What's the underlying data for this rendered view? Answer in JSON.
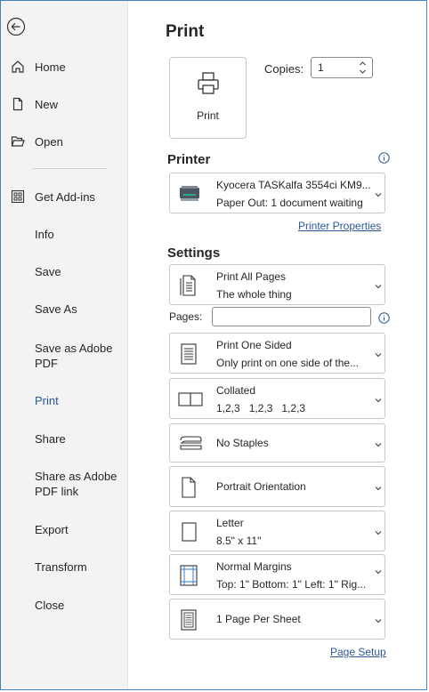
{
  "nav": {
    "back_label": "",
    "items": [
      {
        "label": "Home",
        "icon": "home-icon"
      },
      {
        "label": "New",
        "icon": "new-document-icon"
      },
      {
        "label": "Open",
        "icon": "folder-open-icon"
      },
      {
        "label": "Get Add-ins",
        "icon": "add-ins-icon"
      },
      {
        "label": "Info"
      },
      {
        "label": "Save"
      },
      {
        "label": "Save As"
      },
      {
        "label": "Save as Adobe PDF"
      },
      {
        "label": "Print",
        "active": true
      },
      {
        "label": "Share"
      },
      {
        "label": "Share as Adobe PDF link"
      },
      {
        "label": "Export"
      },
      {
        "label": "Transform"
      },
      {
        "label": "Close"
      }
    ]
  },
  "main": {
    "title": "Print",
    "print_button_label": "Print",
    "copies_label": "Copies:",
    "copies_value": "1",
    "printer_heading": "Printer",
    "printer": {
      "name": "Kyocera TASKalfa 3554ci KM9...",
      "status": "Paper Out: 1 document waiting"
    },
    "printer_properties_link": "Printer Properties",
    "settings_heading": "Settings",
    "pages_label": "Pages:",
    "pages_value": "",
    "settings": {
      "print_range": {
        "title": "Print All Pages",
        "subtitle": "The whole thing"
      },
      "sides": {
        "title": "Print One Sided",
        "subtitle": "Only print on one side of the..."
      },
      "collation": {
        "title": "Collated",
        "subtitle": "1,2,3   1,2,3   1,2,3"
      },
      "staples": {
        "title": "No Staples"
      },
      "orientation": {
        "title": "Portrait Orientation"
      },
      "paper": {
        "title": "Letter",
        "subtitle": "8.5\" x 11\""
      },
      "margins": {
        "title": "Normal Margins",
        "subtitle": "Top: 1\" Bottom: 1\" Left: 1\" Rig..."
      },
      "per_sheet": {
        "title": "1 Page Per Sheet"
      }
    },
    "page_setup_link": "Page Setup"
  },
  "colors": {
    "accent": "#2b579a",
    "frame": "#4a7fc1",
    "sidebar_bg": "#f3f3f3"
  }
}
